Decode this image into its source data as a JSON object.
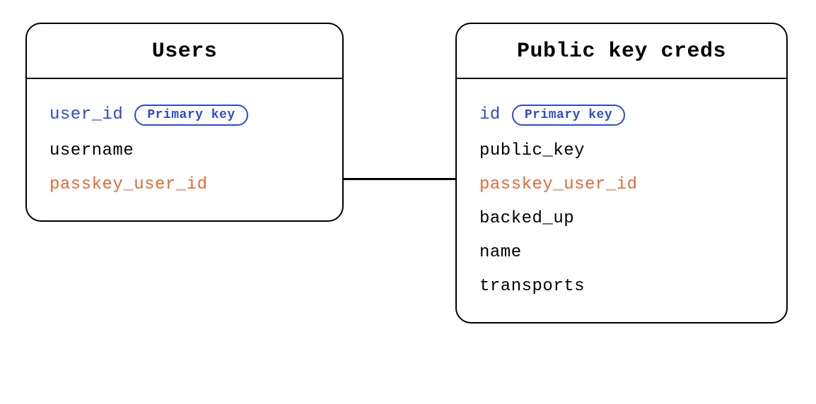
{
  "colors": {
    "primary_key": "#2C4BD5",
    "foreign_key": "#E06B37",
    "normal": "#000000",
    "border": "#000000"
  },
  "badge_label": "Primary key",
  "entities": {
    "users": {
      "title": "Users",
      "fields": {
        "f0": {
          "name": "user_id",
          "role": "primary",
          "badge": true
        },
        "f1": {
          "name": "username",
          "role": "normal",
          "badge": false
        },
        "f2": {
          "name": "passkey_user_id",
          "role": "fk",
          "badge": false
        }
      }
    },
    "creds": {
      "title": "Public key creds",
      "fields": {
        "f0": {
          "name": "id",
          "role": "primary",
          "badge": true
        },
        "f1": {
          "name": "public_key",
          "role": "normal",
          "badge": false
        },
        "f2": {
          "name": "passkey_user_id",
          "role": "fk",
          "badge": false
        },
        "f3": {
          "name": "backed_up",
          "role": "normal",
          "badge": false
        },
        "f4": {
          "name": "name",
          "role": "normal",
          "badge": false
        },
        "f5": {
          "name": "transports",
          "role": "normal",
          "badge": false
        }
      }
    }
  },
  "relationship": {
    "from": "users.passkey_user_id",
    "to": "creds.passkey_user_id"
  }
}
